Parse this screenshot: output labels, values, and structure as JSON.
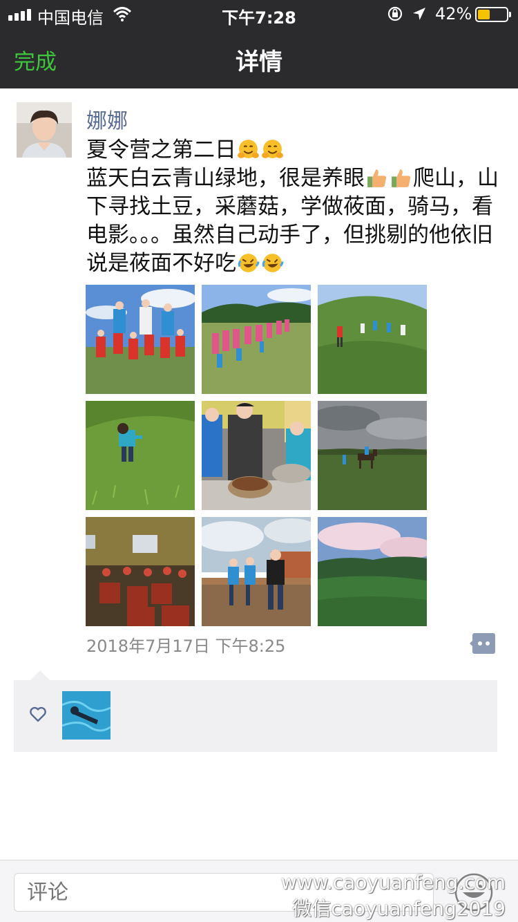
{
  "status_bar": {
    "carrier": "中国电信",
    "time": "下午7:28",
    "battery_percent": "42%",
    "battery_level": 0.42,
    "icons": [
      "signal-icon",
      "wifi-icon",
      "rotation-lock-icon",
      "location-arrow-icon",
      "battery-icon"
    ]
  },
  "nav": {
    "done_label": "完成",
    "title": "详情"
  },
  "post": {
    "author": "娜娜",
    "text_lines": [
      {
        "pre": "夏令营之第二日",
        "emoji": [
          "hugging-face-emoji",
          "hugging-face-emoji"
        ],
        "post": ""
      },
      {
        "pre": "蓝天白云青山绿地，很是养眼",
        "emoji": [
          "thumbs-up-emoji",
          "thumbs-up-emoji"
        ],
        "post": "爬山，山下寻找土豆，采蘑菇，学做莜面，骑马，看电影。。。虽然自己动手了，但挑剔的他依旧说是莜面不好吃"
      },
      {
        "tail_emoji": [
          "rolling-laughing-emoji",
          "rolling-laughing-emoji"
        ]
      }
    ],
    "photos": [
      "group-photo-blue-sky",
      "kids-line-on-hill",
      "kids-walking-grassland",
      "boy-picking-mushrooms",
      "making-youmian",
      "horse-riding-grassland",
      "movie-room",
      "boys-sitting-on-wall",
      "green-hills-landscape"
    ],
    "timestamp": "2018年7月17日 下午8:25"
  },
  "likes": {
    "icon": "heart-outline-icon",
    "liker_avatar": "swimmer-avatar"
  },
  "input_bar": {
    "placeholder": "评论",
    "emoji_button": "emoji-face-icon"
  },
  "watermark": {
    "line1": "www.caoyuanfeng.com",
    "line2": "微信caoyuanfeng2019"
  },
  "colors": {
    "header_bg": "#2b2b2d",
    "accent_green": "#3ec73e",
    "author_blue": "#576b95",
    "meta_gray": "#888888",
    "likes_bg": "#f0f0f3"
  }
}
